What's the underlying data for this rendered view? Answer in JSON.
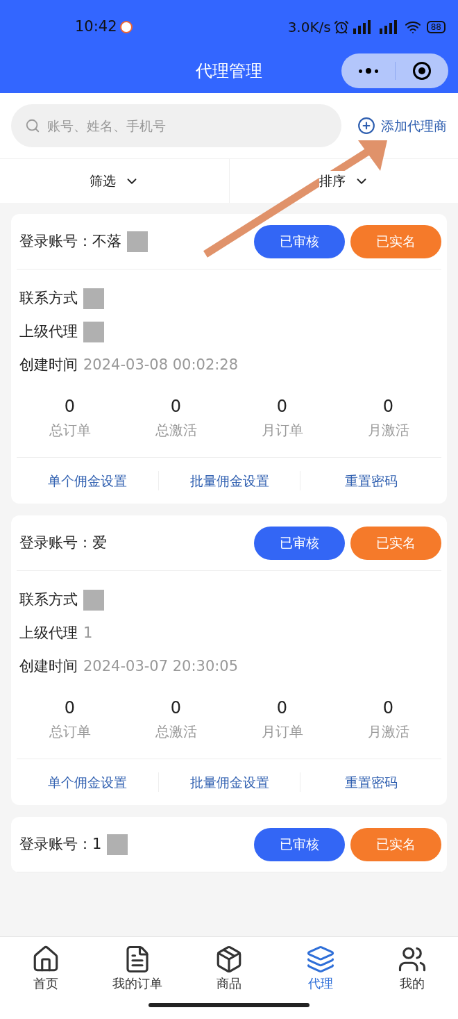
{
  "status_bar": {
    "time": "10:42",
    "speed": "3.0K/s",
    "battery": "88"
  },
  "header": {
    "title": "代理管理"
  },
  "search": {
    "placeholder": "账号、姓名、手机号"
  },
  "add_button": {
    "label": "添加代理商"
  },
  "filters": [
    {
      "label": "筛选"
    },
    {
      "label": "排序"
    }
  ],
  "agents": [
    {
      "account": {
        "label": "登录账号：",
        "value": "不落",
        "masked": true
      },
      "fields": [
        {
          "label": "联系方式",
          "masked": true
        },
        {
          "label": "上级代理",
          "masked": true
        },
        {
          "label": "创建时间",
          "value": "2024-03-08 00:02:28"
        }
      ],
      "badges": [
        {
          "label": "已审核",
          "kind": "reviewed"
        },
        {
          "label": "已实名",
          "kind": "verified"
        }
      ],
      "stats": [
        {
          "value": "0",
          "label": "总订单"
        },
        {
          "value": "0",
          "label": "总激活"
        },
        {
          "value": "0",
          "label": "月订单"
        },
        {
          "value": "0",
          "label": "月激活"
        }
      ],
      "actions": [
        "单个佣金设置",
        "批量佣金设置",
        "重置密码"
      ]
    },
    {
      "account": {
        "label": "登录账号：",
        "value": "爱"
      },
      "fields": [
        {
          "label": "联系方式",
          "masked": true
        },
        {
          "label": "上级代理",
          "value": "1"
        },
        {
          "label": "创建时间",
          "value": "2024-03-07 20:30:05"
        }
      ],
      "badges": [
        {
          "label": "已审核",
          "kind": "reviewed"
        },
        {
          "label": "已实名",
          "kind": "verified"
        }
      ],
      "stats": [
        {
          "value": "0",
          "label": "总订单"
        },
        {
          "value": "0",
          "label": "总激活"
        },
        {
          "value": "0",
          "label": "月订单"
        },
        {
          "value": "0",
          "label": "月激活"
        }
      ],
      "actions": [
        "单个佣金设置",
        "批量佣金设置",
        "重置密码"
      ]
    },
    {
      "account": {
        "label": "登录账号：",
        "value": "1",
        "masked": true
      },
      "badges": [
        {
          "label": "已审核",
          "kind": "reviewed"
        },
        {
          "label": "已实名",
          "kind": "verified"
        }
      ]
    }
  ],
  "tabs": [
    {
      "label": "首页",
      "kind": "home",
      "selected": false
    },
    {
      "label": "我的订单",
      "kind": "orders",
      "selected": false
    },
    {
      "label": "商品",
      "kind": "goods",
      "selected": false
    },
    {
      "label": "代理",
      "kind": "agents",
      "selected": true
    },
    {
      "label": "我的",
      "kind": "mine",
      "selected": false
    }
  ]
}
